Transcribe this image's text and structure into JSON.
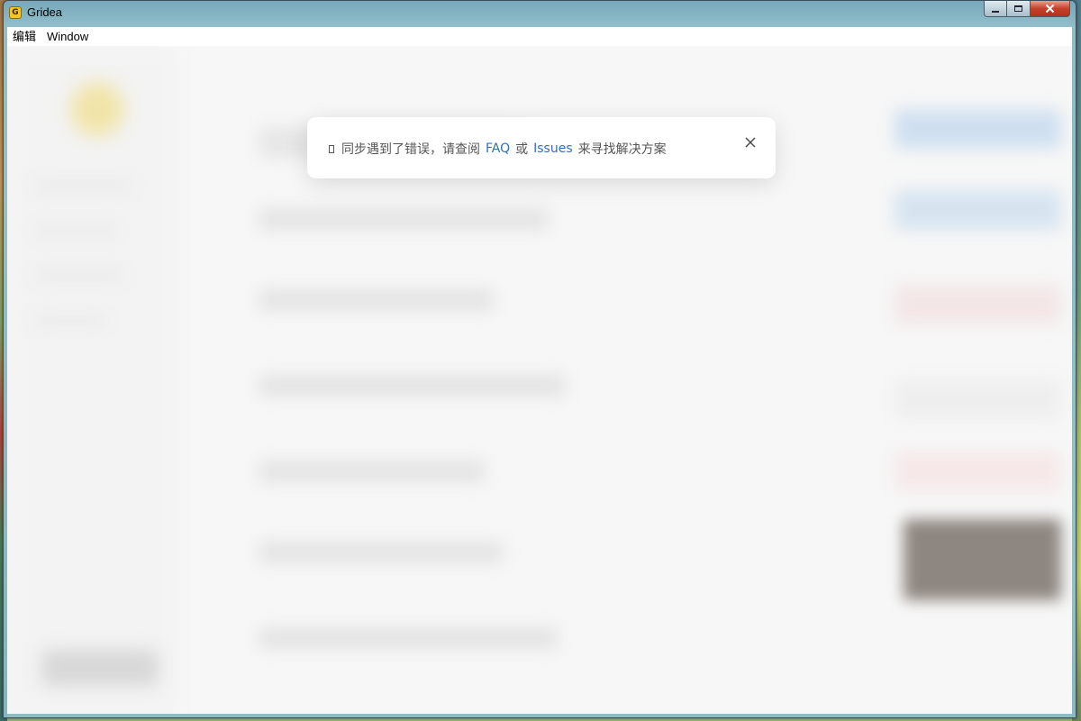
{
  "window": {
    "title": "Gridea",
    "icon": "gridea-app-icon",
    "controls": {
      "minimize": "minimize-icon",
      "maximize": "maximize-icon",
      "close": "close-icon"
    }
  },
  "menubar": {
    "items": [
      {
        "label": "编辑"
      },
      {
        "label": "Window"
      }
    ]
  },
  "dialog": {
    "icon": "error-icon",
    "prefix": "同步遇到了错误，请查阅",
    "link_faq": "FAQ",
    "middle": "或",
    "link_issues": "Issues",
    "suffix": "来寻找解决方案",
    "close_icon": "close-icon",
    "link_color": "#2d6fc4"
  }
}
